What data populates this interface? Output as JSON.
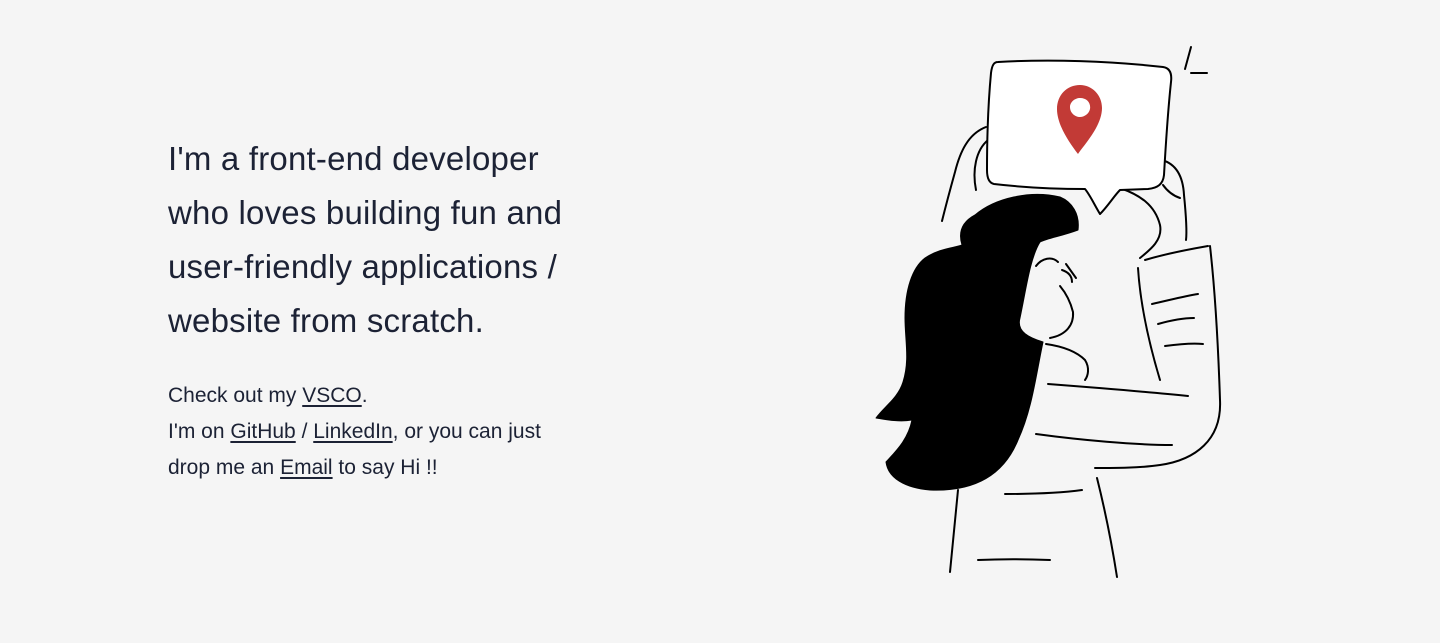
{
  "intro": {
    "headline_lines": [
      "I'm a front-end developer",
      "who loves building fun and",
      "user-friendly applications /",
      "website from scratch."
    ],
    "vsco": {
      "prefix": "Check out my ",
      "link": "VSCO",
      "suffix": "."
    },
    "social": {
      "prefix": "I'm on ",
      "github": "GitHub",
      "separator": " / ",
      "linkedin": "LinkedIn",
      "suffix": ", or you can just"
    },
    "email": {
      "prefix": "drop me an ",
      "link": "Email",
      "suffix": " to say Hi !!"
    }
  },
  "illustration": {
    "icon": "location-pin-icon",
    "pin_color": "#c23a36",
    "hair_color": "#000000"
  }
}
